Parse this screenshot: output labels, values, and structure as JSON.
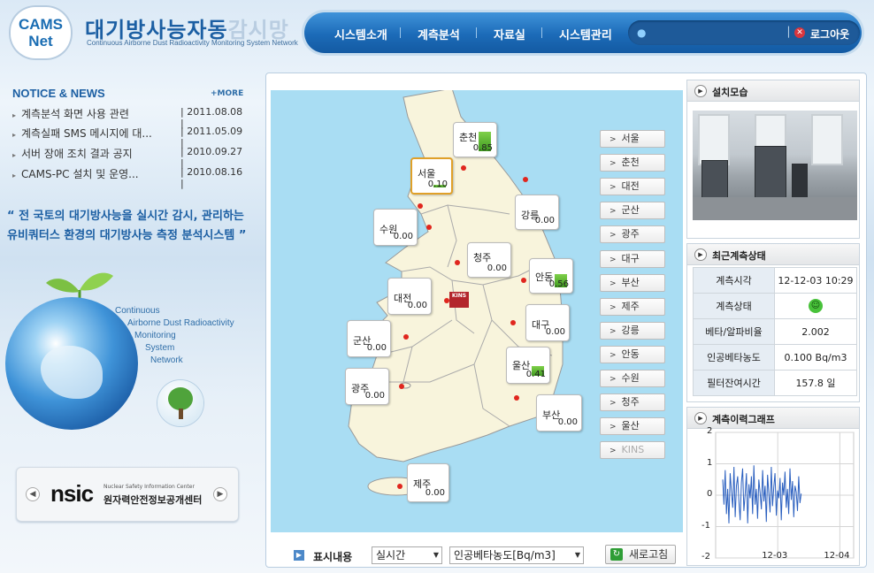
{
  "header": {
    "logo_line1": "CAMS",
    "logo_line2": "Net",
    "title_main": "대기방사능자동",
    "title_dim": "감시망",
    "subtitle": "Continuous Airborne Dust Radioactivity Monitoring System Network"
  },
  "nav": {
    "items": [
      "시스템소개",
      "계측분석",
      "자료실",
      "시스템관리"
    ],
    "logout_label": "로그아웃"
  },
  "notice": {
    "title": "NOTICE & NEWS",
    "more": "+MORE",
    "items": [
      {
        "text": "계측분석 화면 사용 관련",
        "date": "| 2011.08.08 |"
      },
      {
        "text": "계측실패 SMS 메시지에 대...",
        "date": "| 2011.05.09 |"
      },
      {
        "text": "서버 장애 조치 결과 공지",
        "date": "| 2010.09.27 |"
      },
      {
        "text": "CAMS-PC 설치 및 운영...",
        "date": "| 2010.08.16 |"
      }
    ]
  },
  "slogan": {
    "line1": "“ 전 국토의 대기방사능을 실시간 감시, 관리하는",
    "line2": "유비쿼터스 환경의 대기방사능 측정 분석시스템 ”"
  },
  "cams_text": [
    "Continuous",
    "Airborne Dust Radioactivity",
    "Monitoring",
    "System",
    "Network"
  ],
  "banner": {
    "logo": "nsic",
    "en": "Nuclear Safety Information Center",
    "ko": "원자력안전정보공개센터"
  },
  "map": {
    "kins_mark": "KINS",
    "stations": [
      {
        "name": "춘천",
        "value": "0.85",
        "bar": 0.85
      },
      {
        "name": "서울",
        "value": "0.10",
        "bar": 0.1
      },
      {
        "name": "강릉",
        "value": "0.00",
        "bar": 0
      },
      {
        "name": "수원",
        "value": "0.00",
        "bar": 0
      },
      {
        "name": "청주",
        "value": "0.00",
        "bar": 0
      },
      {
        "name": "안동",
        "value": "0.56",
        "bar": 0.56
      },
      {
        "name": "대전",
        "value": "0.00",
        "bar": 0
      },
      {
        "name": "대구",
        "value": "0.00",
        "bar": 0
      },
      {
        "name": "군산",
        "value": "0.00",
        "bar": 0
      },
      {
        "name": "울산",
        "value": "0.41",
        "bar": 0.41
      },
      {
        "name": "광주",
        "value": "0.00",
        "bar": 0
      },
      {
        "name": "부산",
        "value": "0.00",
        "bar": 0
      },
      {
        "name": "제주",
        "value": "0.00",
        "bar": 0
      }
    ],
    "city_buttons": [
      "서울",
      "춘천",
      "대전",
      "군산",
      "광주",
      "대구",
      "부산",
      "제주",
      "강릉",
      "안동",
      "수원",
      "청주",
      "울산",
      "KINS"
    ]
  },
  "controls": {
    "display_label": "표시내용",
    "mode_value": "실시간",
    "metric_value": "인공베타농도[Bq/m3]",
    "refresh_label": "새로고침"
  },
  "install": {
    "title": "설치모습"
  },
  "status": {
    "title": "최근계측상태",
    "rows": [
      {
        "key": "계측시각",
        "value": "12-12-03 10:29"
      },
      {
        "key": "계측상태",
        "value": ""
      },
      {
        "key": "베타/알파비율",
        "value": "2.002"
      },
      {
        "key": "인공베타농도",
        "value": "0.100 Bq/m3"
      },
      {
        "key": "필터잔여시간",
        "value": "157.8 일"
      }
    ],
    "status_icon": "smiley-icon"
  },
  "history": {
    "title": "계측이력그래프"
  },
  "chart_data": {
    "type": "line",
    "yticks": [
      "2",
      "1",
      "0",
      "-1",
      "-2"
    ],
    "xticks": [
      "12-03",
      "12-04"
    ],
    "ylim": [
      -2,
      2
    ],
    "series": [
      {
        "values": [
          0.5,
          -0.3,
          0.8,
          -0.6,
          0.2,
          -0.9,
          0.7,
          0.1,
          -0.4,
          0.9,
          -0.7,
          0.3,
          0.6,
          -0.2,
          -0.8,
          0.4,
          0.85,
          -0.5,
          0.0,
          0.7,
          -0.9,
          0.35,
          -0.1,
          0.6,
          -0.6,
          0.95,
          -0.3,
          0.2,
          -0.75,
          0.5,
          0.1,
          -0.45,
          0.8,
          -0.2,
          0.3,
          -0.85,
          0.65,
          0.05,
          -0.55,
          0.9,
          -0.35,
          0.25,
          0.7,
          -0.65,
          0.15,
          -0.1,
          0.55,
          -0.8,
          0.4,
          0.0,
          0.75,
          -0.4,
          0.2,
          -0.6,
          0.85,
          -0.15,
          0.45,
          -0.7,
          0.3,
          0.1,
          -0.5,
          0.6,
          -0.25,
          0.05
        ]
      }
    ]
  },
  "colors": {
    "brand_blue": "#1c5fa3",
    "nav_blue": "#1c6bb8",
    "map_water": "#a9ddf3",
    "land": "#f8f4dc",
    "station_dot": "#e0261e",
    "bar_green": "#5bb52e"
  }
}
